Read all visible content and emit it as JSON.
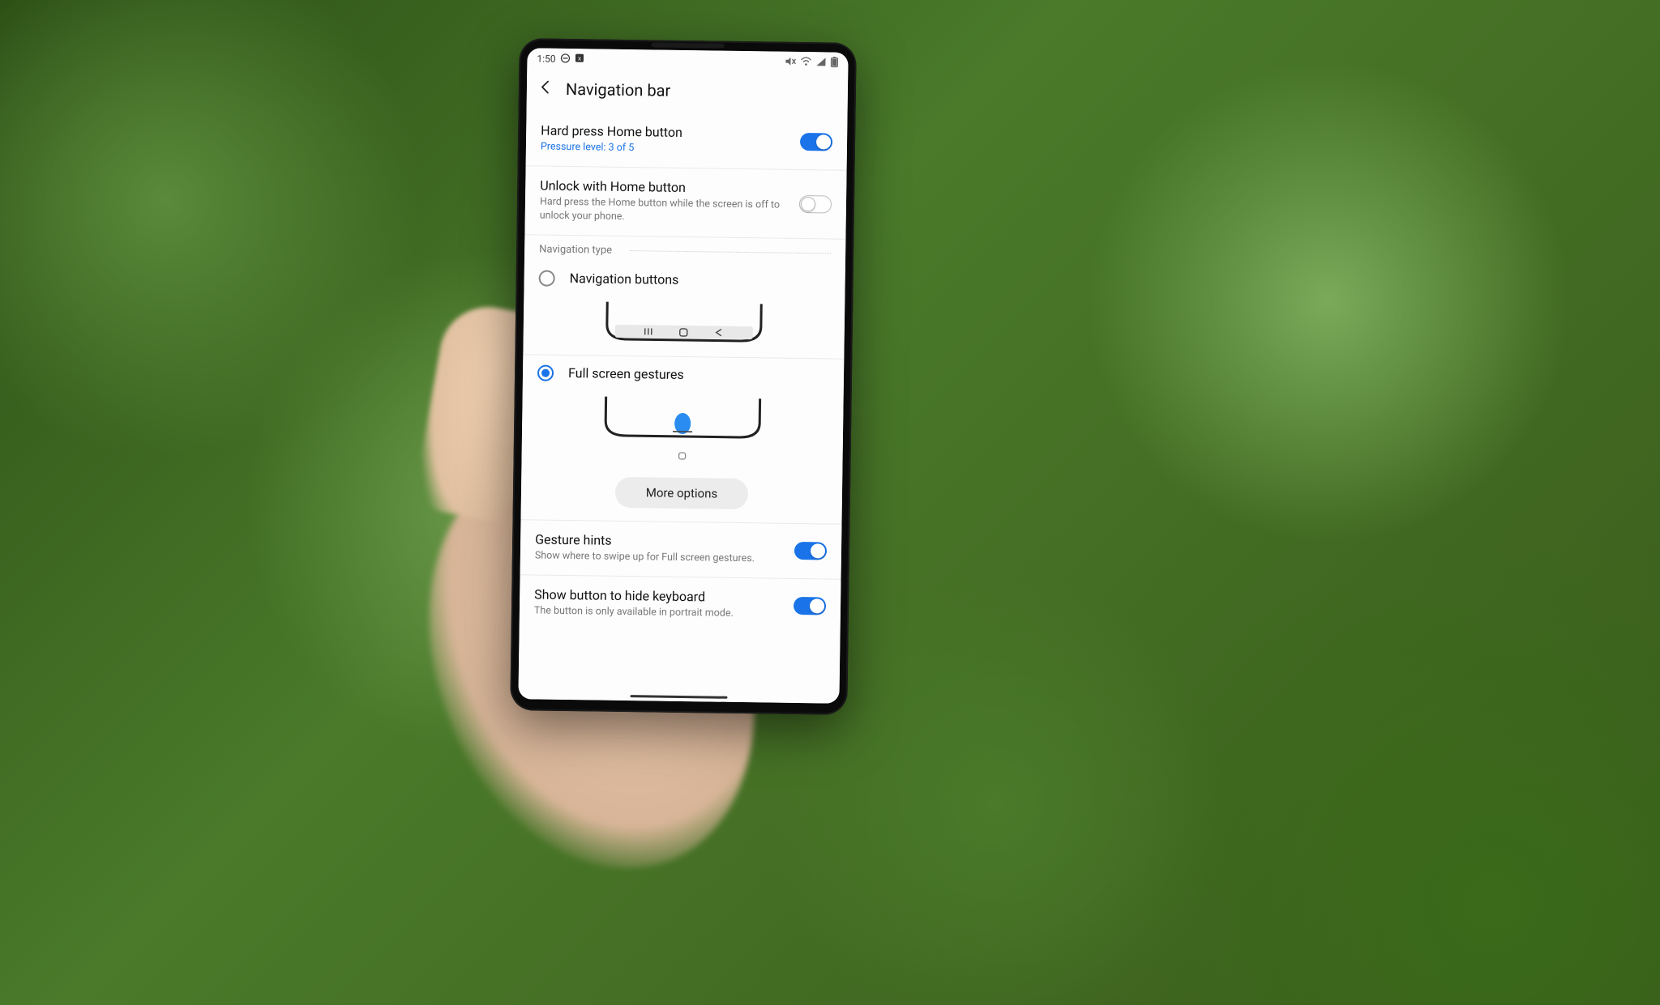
{
  "status": {
    "time": "1:50",
    "icons_left": [
      "no-disturb",
      "mute-badge"
    ],
    "icons_right": [
      "mute",
      "wifi",
      "signal",
      "battery"
    ]
  },
  "header": {
    "title": "Navigation bar"
  },
  "rows": {
    "hard_press": {
      "title": "Hard press Home button",
      "sub": "Pressure level: 3 of 5",
      "toggle": true
    },
    "unlock": {
      "title": "Unlock with Home button",
      "sub": "Hard press the Home button while the screen is off to unlock your phone.",
      "toggle": false
    },
    "gesture_hints": {
      "title": "Gesture hints",
      "sub": "Show where to swipe up for Full screen gestures.",
      "toggle": true
    },
    "show_button": {
      "title": "Show button to hide keyboard",
      "sub": "The button is only available in portrait mode.",
      "toggle": true
    }
  },
  "section": {
    "nav_type": "Navigation type"
  },
  "nav_options": {
    "buttons": {
      "label": "Navigation buttons",
      "selected": false
    },
    "gestures": {
      "label": "Full screen gestures",
      "selected": true
    }
  },
  "more_options": "More options"
}
